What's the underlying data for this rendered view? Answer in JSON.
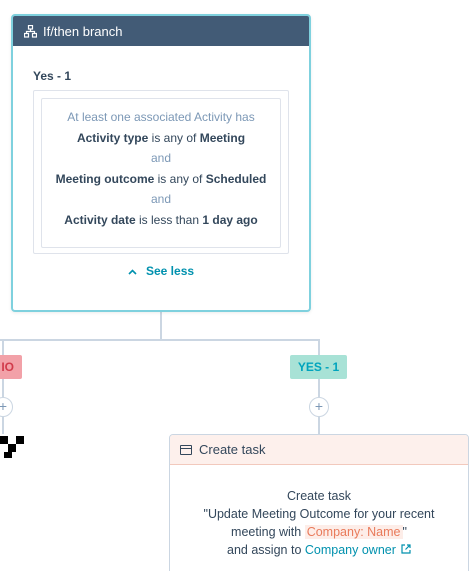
{
  "ifthen": {
    "title": "If/then branch",
    "branch_label": "Yes - 1",
    "intro": "At least one associated Activity has",
    "conditions": [
      {
        "field": "Activity type",
        "op": "is any of",
        "value": "Meeting"
      },
      {
        "joiner": "and"
      },
      {
        "field": "Meeting outcome",
        "op": "is any of",
        "value": "Scheduled"
      },
      {
        "joiner": "and"
      },
      {
        "field": "Activity date",
        "op": "is less than",
        "value": "1 day ago"
      }
    ],
    "see_less": "See less"
  },
  "branches": {
    "no_label": "IO",
    "yes_label": "YES - 1"
  },
  "task": {
    "header": "Create task",
    "title": "Create task",
    "line1": "\"Update Meeting Outcome for your recent",
    "line2_prefix": "meeting with ",
    "token": "Company: Name",
    "line2_suffix": "\"",
    "line3_prefix": "and assign to ",
    "owner_link": "Company owner"
  },
  "icons": {
    "ifthen": "branch-icon",
    "see_less": "chevron-up-icon",
    "plus": "plus-icon",
    "task": "task-icon",
    "external": "external-link-icon"
  },
  "colors": {
    "header_dark": "#425b76",
    "accent_teal": "#00a4bd",
    "no_red": "#d13b4b",
    "token_orange": "#e97b5b"
  }
}
